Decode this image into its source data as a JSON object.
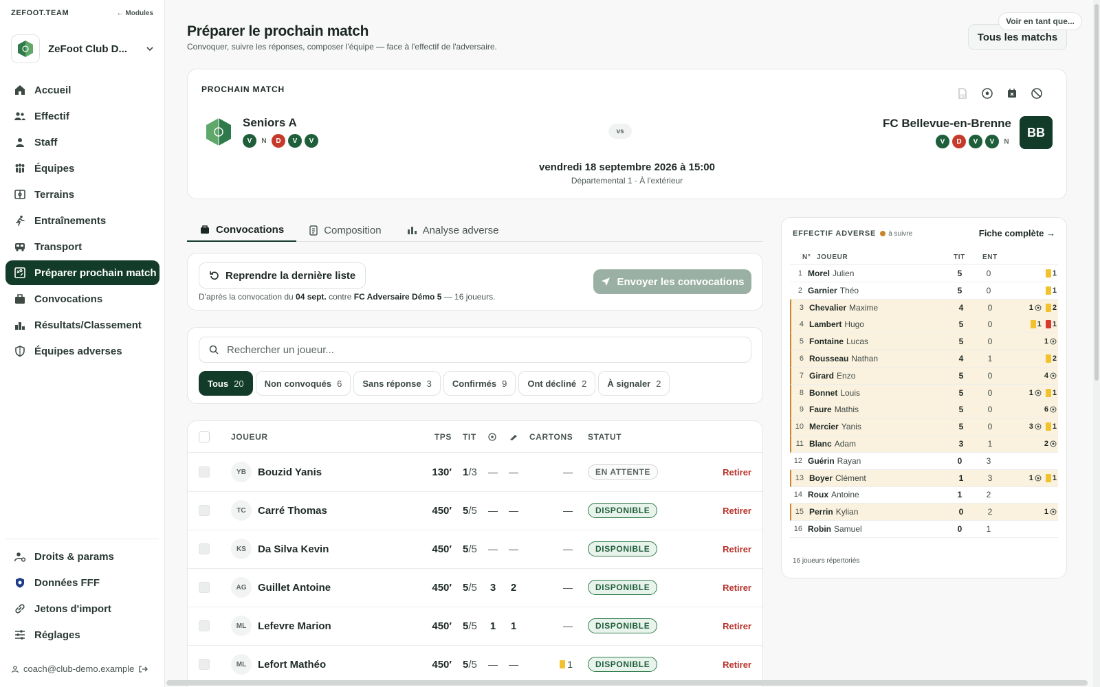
{
  "sidebar": {
    "brand": "ZEFOOT.TEAM",
    "modules_link": "← Modules",
    "club_name": "ZeFoot Club D...",
    "nav": [
      {
        "label": "Accueil",
        "icon": "home-icon",
        "name": "nav-accueil"
      },
      {
        "label": "Effectif",
        "icon": "users-icon",
        "name": "nav-effectif"
      },
      {
        "label": "Staff",
        "icon": "user-icon",
        "name": "nav-staff"
      },
      {
        "label": "Équipes",
        "icon": "teams-icon",
        "name": "nav-equipes"
      },
      {
        "label": "Terrains",
        "icon": "field-icon",
        "name": "nav-terrains"
      },
      {
        "label": "Entraînements",
        "icon": "run-icon",
        "name": "nav-entrainements"
      },
      {
        "label": "Transport",
        "icon": "bus-icon",
        "name": "nav-transport"
      },
      {
        "label": "Préparer prochain match",
        "icon": "board-icon",
        "name": "nav-preparer-match"
      },
      {
        "label": "Convocations",
        "icon": "bag-icon",
        "name": "nav-convocations"
      },
      {
        "label": "Résultats/Classement",
        "icon": "ranking-icon",
        "name": "nav-resultats"
      },
      {
        "label": "Équipes adverses",
        "icon": "shield-icon",
        "name": "nav-equipes-adverses"
      }
    ],
    "nav_bottom": [
      {
        "label": "Droits & params",
        "icon": "user-settings-icon",
        "name": "nav-droits"
      },
      {
        "label": "Données FFF",
        "icon": "fff-icon",
        "name": "nav-donnees-fff"
      },
      {
        "label": "Jetons d'import",
        "icon": "link-icon",
        "name": "nav-jetons"
      },
      {
        "label": "Réglages",
        "icon": "sliders-icon",
        "name": "nav-reglages"
      }
    ],
    "user_email": "coach@club-demo.example"
  },
  "header": {
    "title": "Préparer le prochain match",
    "subtitle": "Convoquer, suivre les réponses, composer l'équipe — face à l'effectif de l'adversaire.",
    "view_as_label": "Voir en tant que...",
    "all_matches_label": "Tous les matchs"
  },
  "match": {
    "label": "PROCHAIN MATCH",
    "home_team": "Seniors A",
    "home_form": [
      "V",
      "N",
      "D",
      "V",
      "V"
    ],
    "vs": "vs",
    "away_team": "FC Bellevue-en-Brenne",
    "away_initials": "BB",
    "away_form": [
      "V",
      "D",
      "V",
      "V",
      "N"
    ],
    "date": "vendredi 18 septembre 2026 à 15:00",
    "competition": "Départemental 1 · À l'extérieur"
  },
  "tabs": [
    {
      "label": "Convocations",
      "icon": "bag-icon"
    },
    {
      "label": "Composition",
      "icon": "clipboard-icon"
    },
    {
      "label": "Analyse adverse",
      "icon": "bars-icon"
    }
  ],
  "convocation": {
    "reprise_label": "Reprendre la dernière liste",
    "send_label": "Envoyer les convocations",
    "note_prefix": "D'après la convocation du ",
    "note_date": "04 sept.",
    "note_mid": " contre ",
    "note_team": "FC Adversaire Démo 5",
    "note_suffix": " — 16 joueurs."
  },
  "search": {
    "placeholder": "Rechercher un joueur...",
    "chips": [
      {
        "label": "Tous",
        "count": "20"
      },
      {
        "label": "Non convoqués",
        "count": "6"
      },
      {
        "label": "Sans réponse",
        "count": "3"
      },
      {
        "label": "Confirmés",
        "count": "9"
      },
      {
        "label": "Ont décliné",
        "count": "2"
      },
      {
        "label": "À signaler",
        "count": "2"
      }
    ]
  },
  "roster": {
    "headers": {
      "joueur": "JOUEUR",
      "tps": "TPS",
      "tit": "TIT",
      "cartons": "CARTONS",
      "statut": "STATUT"
    },
    "remove_label": "Retirer",
    "rows": [
      {
        "initials": "YB",
        "name": "Bouzid Yanis",
        "tps": "130′",
        "tit": "1",
        "tit_total": "/3",
        "goals": "—",
        "assists": "—",
        "cards": "—",
        "yellow": 0,
        "status": "EN ATTENTE",
        "status_kind": "wait"
      },
      {
        "initials": "TC",
        "name": "Carré Thomas",
        "tps": "450′",
        "tit": "5",
        "tit_total": "/5",
        "goals": "—",
        "assists": "—",
        "cards": "—",
        "yellow": 0,
        "status": "DISPONIBLE",
        "status_kind": "ok"
      },
      {
        "initials": "KS",
        "name": "Da Silva Kevin",
        "tps": "450′",
        "tit": "5",
        "tit_total": "/5",
        "goals": "—",
        "assists": "—",
        "cards": "—",
        "yellow": 0,
        "status": "DISPONIBLE",
        "status_kind": "ok"
      },
      {
        "initials": "AG",
        "name": "Guillet Antoine",
        "tps": "450′",
        "tit": "5",
        "tit_total": "/5",
        "goals": "3",
        "assists": "2",
        "cards": "—",
        "yellow": 0,
        "status": "DISPONIBLE",
        "status_kind": "ok"
      },
      {
        "initials": "ML",
        "name": "Lefevre Marion",
        "tps": "450′",
        "tit": "5",
        "tit_total": "/5",
        "goals": "1",
        "assists": "1",
        "cards": "—",
        "yellow": 0,
        "status": "DISPONIBLE",
        "status_kind": "ok"
      },
      {
        "initials": "ML",
        "name": "Lefort Mathéo",
        "tps": "450′",
        "tit": "5",
        "tit_total": "/5",
        "goals": "—",
        "assists": "—",
        "cards": "1",
        "yellow": 1,
        "status": "DISPONIBLE",
        "status_kind": "ok"
      }
    ]
  },
  "opponent": {
    "title": "EFFECTIF ADVERSE",
    "legend": "à suivre",
    "link": "Fiche complète →",
    "headers": {
      "num": "N°",
      "player": "JOUEUR",
      "tit": "TIT",
      "ent": "ENT"
    },
    "players": [
      {
        "n": "1",
        "last": "Morel",
        "first": "Julien",
        "tit": "5",
        "ent": "0",
        "flag": false,
        "goals": "",
        "yellow": "1",
        "red": ""
      },
      {
        "n": "2",
        "last": "Garnier",
        "first": "Théo",
        "tit": "5",
        "ent": "0",
        "flag": false,
        "goals": "",
        "yellow": "1",
        "red": ""
      },
      {
        "n": "3",
        "last": "Chevalier",
        "first": "Maxime",
        "tit": "4",
        "ent": "0",
        "flag": true,
        "goals": "1",
        "yellow": "2",
        "red": ""
      },
      {
        "n": "4",
        "last": "Lambert",
        "first": "Hugo",
        "tit": "5",
        "ent": "0",
        "flag": true,
        "goals": "",
        "yellow": "1",
        "red": "1"
      },
      {
        "n": "5",
        "last": "Fontaine",
        "first": "Lucas",
        "tit": "5",
        "ent": "0",
        "flag": true,
        "goals": "1",
        "yellow": "",
        "red": ""
      },
      {
        "n": "6",
        "last": "Rousseau",
        "first": "Nathan",
        "tit": "4",
        "ent": "1",
        "flag": true,
        "goals": "",
        "yellow": "2",
        "red": ""
      },
      {
        "n": "7",
        "last": "Girard",
        "first": "Enzo",
        "tit": "5",
        "ent": "0",
        "flag": true,
        "goals": "4",
        "yellow": "",
        "red": ""
      },
      {
        "n": "8",
        "last": "Bonnet",
        "first": "Louis",
        "tit": "5",
        "ent": "0",
        "flag": true,
        "goals": "1",
        "yellow": "1",
        "red": ""
      },
      {
        "n": "9",
        "last": "Faure",
        "first": "Mathis",
        "tit": "5",
        "ent": "0",
        "flag": true,
        "goals": "6",
        "yellow": "",
        "red": ""
      },
      {
        "n": "10",
        "last": "Mercier",
        "first": "Yanis",
        "tit": "5",
        "ent": "0",
        "flag": true,
        "goals": "3",
        "yellow": "1",
        "red": ""
      },
      {
        "n": "11",
        "last": "Blanc",
        "first": "Adam",
        "tit": "3",
        "ent": "1",
        "flag": true,
        "goals": "2",
        "yellow": "",
        "red": ""
      },
      {
        "n": "12",
        "last": "Guérin",
        "first": "Rayan",
        "tit": "0",
        "ent": "3",
        "flag": false,
        "goals": "",
        "yellow": "",
        "red": ""
      },
      {
        "n": "13",
        "last": "Boyer",
        "first": "Clément",
        "tit": "1",
        "ent": "3",
        "flag": true,
        "goals": "1",
        "yellow": "1",
        "red": ""
      },
      {
        "n": "14",
        "last": "Roux",
        "first": "Antoine",
        "tit": "1",
        "ent": "2",
        "flag": false,
        "goals": "",
        "yellow": "",
        "red": ""
      },
      {
        "n": "15",
        "last": "Perrin",
        "first": "Kylian",
        "tit": "0",
        "ent": "2",
        "flag": true,
        "goals": "1",
        "yellow": "",
        "red": ""
      },
      {
        "n": "16",
        "last": "Robin",
        "first": "Samuel",
        "tit": "0",
        "ent": "1",
        "flag": false,
        "goals": "",
        "yellow": "",
        "red": ""
      }
    ],
    "footer": "16 joueurs répertoriés"
  },
  "colors": {
    "brand_dark": "#133b2a",
    "win": "#1f5e3a",
    "loss": "#c63a2c",
    "watch": "#c9852b",
    "danger": "#b8322a"
  }
}
